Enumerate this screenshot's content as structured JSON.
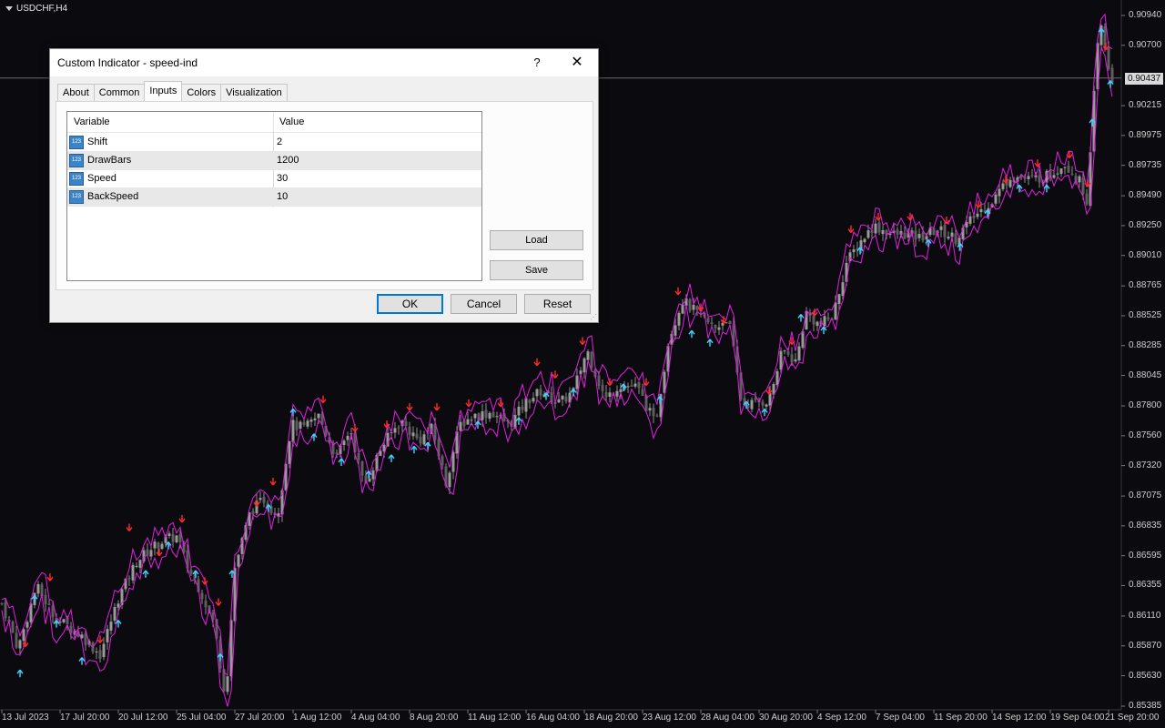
{
  "chart": {
    "symbol": "USDCHF,H4",
    "current_price": "0.90437",
    "price_labels": [
      "0.90940",
      "0.90700",
      "0.90215",
      "0.89975",
      "0.89735",
      "0.89490",
      "0.89250",
      "0.89010",
      "0.88765",
      "0.88525",
      "0.88285",
      "0.88045",
      "0.87800",
      "0.87560",
      "0.87320",
      "0.87075",
      "0.86835",
      "0.86595",
      "0.86355",
      "0.86110",
      "0.85870",
      "0.85630",
      "0.85385"
    ],
    "time_labels": [
      "13 Jul 2023",
      "17 Jul 20:00",
      "20 Jul 12:00",
      "25 Jul 04:00",
      "27 Jul 20:00",
      "1 Aug 12:00",
      "4 Aug 04:00",
      "8 Aug 20:00",
      "11 Aug 12:00",
      "16 Aug 04:00",
      "18 Aug 20:00",
      "23 Aug 12:00",
      "28 Aug 04:00",
      "30 Aug 20:00",
      "4 Sep 12:00",
      "7 Sep 04:00",
      "11 Sep 20:00",
      "14 Sep 12:00",
      "19 Sep 04:00",
      "21 Sep 20:00"
    ],
    "colors": {
      "background": "#0b0b0f",
      "candle": "#8c8c8c",
      "indicator_line": "#e020e0",
      "arrow_up": "#3fd4ff",
      "arrow_down": "#ff2a2a",
      "axis_text": "#cfcfcf"
    },
    "price_min": 0.85385,
    "price_max": 0.9094,
    "price_path": [
      [
        0,
        0.8625
      ],
      [
        20,
        0.8585
      ],
      [
        40,
        0.8635
      ],
      [
        60,
        0.861
      ],
      [
        90,
        0.8595
      ],
      [
        110,
        0.858
      ],
      [
        130,
        0.8625
      ],
      [
        150,
        0.8655
      ],
      [
        165,
        0.8665
      ],
      [
        180,
        0.8672
      ],
      [
        195,
        0.8675
      ],
      [
        205,
        0.8652
      ],
      [
        220,
        0.8632
      ],
      [
        235,
        0.8605
      ],
      [
        248,
        0.8545
      ],
      [
        258,
        0.865
      ],
      [
        275,
        0.8695
      ],
      [
        290,
        0.8705
      ],
      [
        305,
        0.8692
      ],
      [
        320,
        0.8765
      ],
      [
        335,
        0.8762
      ],
      [
        350,
        0.8772
      ],
      [
        370,
        0.8738
      ],
      [
        385,
        0.8762
      ],
      [
        400,
        0.8715
      ],
      [
        420,
        0.8748
      ],
      [
        440,
        0.8768
      ],
      [
        460,
        0.8752
      ],
      [
        475,
        0.8762
      ],
      [
        490,
        0.8718
      ],
      [
        505,
        0.8765
      ],
      [
        520,
        0.8772
      ],
      [
        540,
        0.8775
      ],
      [
        560,
        0.8765
      ],
      [
        580,
        0.8785
      ],
      [
        595,
        0.8792
      ],
      [
        615,
        0.8782
      ],
      [
        630,
        0.8792
      ],
      [
        645,
        0.8825
      ],
      [
        665,
        0.8785
      ],
      [
        680,
        0.8797
      ],
      [
        700,
        0.8795
      ],
      [
        720,
        0.8765
      ],
      [
        735,
        0.8835
      ],
      [
        750,
        0.8865
      ],
      [
        765,
        0.8855
      ],
      [
        785,
        0.8842
      ],
      [
        800,
        0.8852
      ],
      [
        815,
        0.8782
      ],
      [
        830,
        0.8782
      ],
      [
        845,
        0.8785
      ],
      [
        860,
        0.8825
      ],
      [
        875,
        0.8815
      ],
      [
        885,
        0.8855
      ],
      [
        900,
        0.8845
      ],
      [
        915,
        0.8852
      ],
      [
        930,
        0.8895
      ],
      [
        945,
        0.8912
      ],
      [
        960,
        0.8925
      ],
      [
        980,
        0.8918
      ],
      [
        995,
        0.8918
      ],
      [
        1010,
        0.8915
      ],
      [
        1030,
        0.8922
      ],
      [
        1050,
        0.8915
      ],
      [
        1070,
        0.8932
      ],
      [
        1090,
        0.8945
      ],
      [
        1110,
        0.8965
      ],
      [
        1130,
        0.8962
      ],
      [
        1150,
        0.8965
      ],
      [
        1170,
        0.8975
      ],
      [
        1185,
        0.8962
      ],
      [
        1195,
        0.8945
      ],
      [
        1205,
        0.9065
      ],
      [
        1210,
        0.9085
      ],
      [
        1220,
        0.9042
      ]
    ],
    "arrows": {
      "up": [
        [
          22,
          0.8572
        ],
        [
          38,
          0.8632
        ],
        [
          62,
          0.8612
        ],
        [
          90,
          0.8582
        ],
        [
          130,
          0.8612
        ],
        [
          160,
          0.8652
        ],
        [
          185,
          0.8675
        ],
        [
          215,
          0.8652
        ],
        [
          242,
          0.8585
        ],
        [
          255,
          0.8652
        ],
        [
          295,
          0.8705
        ],
        [
          322,
          0.8782
        ],
        [
          345,
          0.8762
        ],
        [
          375,
          0.8742
        ],
        [
          405,
          0.8732
        ],
        [
          430,
          0.8745
        ],
        [
          455,
          0.8752
        ],
        [
          470,
          0.8755
        ],
        [
          525,
          0.8772
        ],
        [
          570,
          0.8775
        ],
        [
          600,
          0.8795
        ],
        [
          630,
          0.8798
        ],
        [
          685,
          0.8802
        ],
        [
          725,
          0.8792
        ],
        [
          760,
          0.8845
        ],
        [
          780,
          0.8838
        ],
        [
          820,
          0.8788
        ],
        [
          840,
          0.8782
        ],
        [
          880,
          0.8858
        ],
        [
          905,
          0.8848
        ],
        [
          945,
          0.8912
        ],
        [
          1020,
          0.8918
        ],
        [
          1055,
          0.8915
        ],
        [
          1085,
          0.8942
        ],
        [
          1120,
          0.8962
        ],
        [
          1150,
          0.8962
        ],
        [
          1200,
          0.9015
        ],
        [
          1210,
          0.9088
        ],
        [
          1220,
          0.9046
        ]
      ],
      "down": [
        [
          28,
          0.8582
        ],
        [
          55,
          0.8635
        ],
        [
          110,
          0.8585
        ],
        [
          142,
          0.8675
        ],
        [
          175,
          0.8655
        ],
        [
          200,
          0.8682
        ],
        [
          225,
          0.8632
        ],
        [
          240,
          0.8615
        ],
        [
          282,
          0.8695
        ],
        [
          300,
          0.8712
        ],
        [
          355,
          0.8778
        ],
        [
          390,
          0.8755
        ],
        [
          425,
          0.8758
        ],
        [
          450,
          0.8772
        ],
        [
          480,
          0.8772
        ],
        [
          515,
          0.8775
        ],
        [
          550,
          0.8775
        ],
        [
          590,
          0.8808
        ],
        [
          610,
          0.8798
        ],
        [
          640,
          0.8825
        ],
        [
          670,
          0.8792
        ],
        [
          710,
          0.8792
        ],
        [
          745,
          0.8865
        ],
        [
          770,
          0.8852
        ],
        [
          795,
          0.8842
        ],
        [
          845,
          0.8785
        ],
        [
          870,
          0.8825
        ],
        [
          895,
          0.8848
        ],
        [
          935,
          0.8915
        ],
        [
          965,
          0.8925
        ],
        [
          1000,
          0.8925
        ],
        [
          1040,
          0.8922
        ],
        [
          1075,
          0.8935
        ],
        [
          1105,
          0.8955
        ],
        [
          1140,
          0.8968
        ],
        [
          1175,
          0.8975
        ],
        [
          1195,
          0.8952
        ],
        [
          1215,
          0.9062
        ]
      ]
    }
  },
  "dialog": {
    "title": "Custom Indicator - speed-ind",
    "help_label": "?",
    "close_label": "✕",
    "tabs": [
      "About",
      "Common",
      "Inputs",
      "Colors",
      "Visualization"
    ],
    "active_tab": "Inputs",
    "columns": {
      "variable": "Variable",
      "value": "Value"
    },
    "rows": [
      {
        "icon": "123",
        "variable": "Shift",
        "value": "2"
      },
      {
        "icon": "123",
        "variable": "DrawBars",
        "value": "1200"
      },
      {
        "icon": "123",
        "variable": "Speed",
        "value": "30"
      },
      {
        "icon": "123",
        "variable": "BackSpeed",
        "value": "10"
      }
    ],
    "load_label": "Load",
    "save_label": "Save",
    "ok_label": "OK",
    "cancel_label": "Cancel",
    "reset_label": "Reset"
  }
}
